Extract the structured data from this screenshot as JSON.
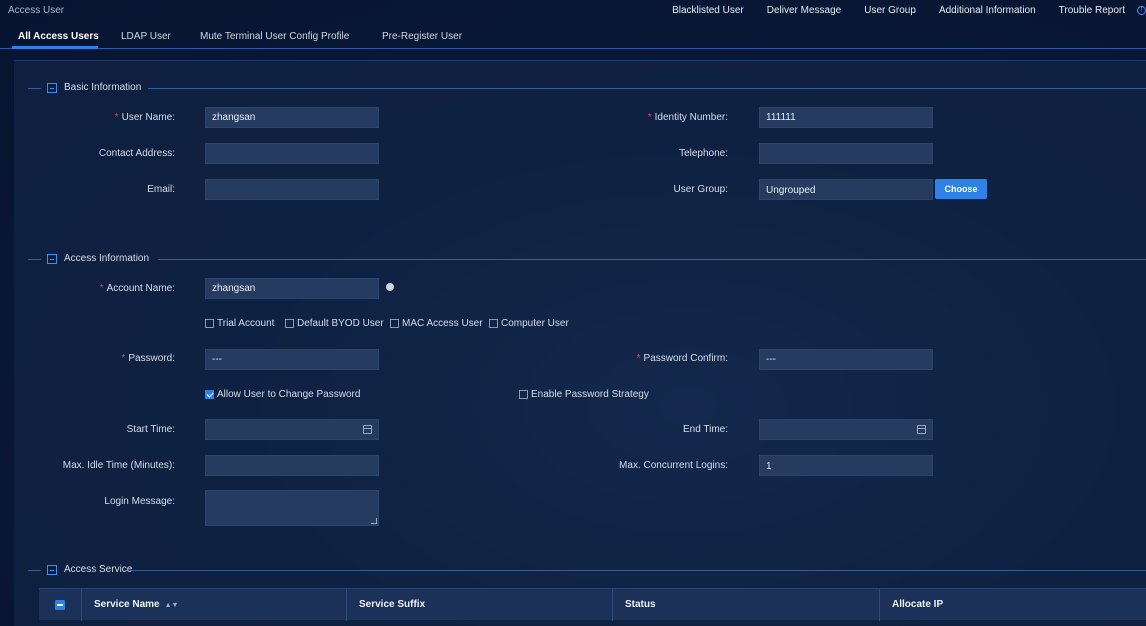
{
  "app": {
    "title": "Access User"
  },
  "top_links": [
    "Blacklisted User",
    "Deliver Message",
    "User Group",
    "Additional Information",
    "Trouble Report"
  ],
  "help_icon_glyph": "!",
  "tabs": [
    "All Access Users",
    "LDAP User",
    "Mute Terminal User Config Profile",
    "Pre-Register User"
  ],
  "sections": {
    "basic": "Basic Information",
    "access": "Access Information",
    "service": "Access Service"
  },
  "basic": {
    "user_name_label": "User Name:",
    "user_name_value": "zhangsan",
    "identity_label": "Identity Number:",
    "identity_value": "111111",
    "contact_label": "Contact Address:",
    "contact_value": "",
    "telephone_label": "Telephone:",
    "telephone_value": "",
    "email_label": "Email:",
    "email_value": "",
    "group_label": "User Group:",
    "group_value": "Ungrouped",
    "choose_label": "Choose"
  },
  "access": {
    "account_label": "Account Name:",
    "account_value": "zhangsan",
    "options": [
      {
        "label": "Trial Account",
        "checked": false
      },
      {
        "label": "Default BYOD User",
        "checked": false
      },
      {
        "label": "MAC Access User",
        "checked": false
      },
      {
        "label": "Computer User",
        "checked": false
      }
    ],
    "password_label": "Password:",
    "password_value": "---",
    "password_confirm_label": "Password Confirm:",
    "password_confirm_value": "---",
    "allow_change_label": "Allow User to Change Password",
    "allow_change_checked": true,
    "enable_strategy_label": "Enable Password Strategy",
    "enable_strategy_checked": false,
    "start_label": "Start Time:",
    "start_value": "",
    "end_label": "End Time:",
    "end_value": "",
    "idle_label": "Max. Idle Time (Minutes):",
    "idle_value": "",
    "concurrent_label": "Max. Concurrent Logins:",
    "concurrent_value": "1",
    "login_msg_label": "Login Message:",
    "login_msg_value": ""
  },
  "required_mark": "*",
  "service_table": {
    "columns": [
      "Service Name",
      "Service Suffix",
      "Status",
      "Allocate IP"
    ],
    "sort_glyph": "▲▼"
  },
  "colors": {
    "accent": "#2e82e6",
    "required": "#e0405a",
    "input_bg": "#253b60"
  }
}
